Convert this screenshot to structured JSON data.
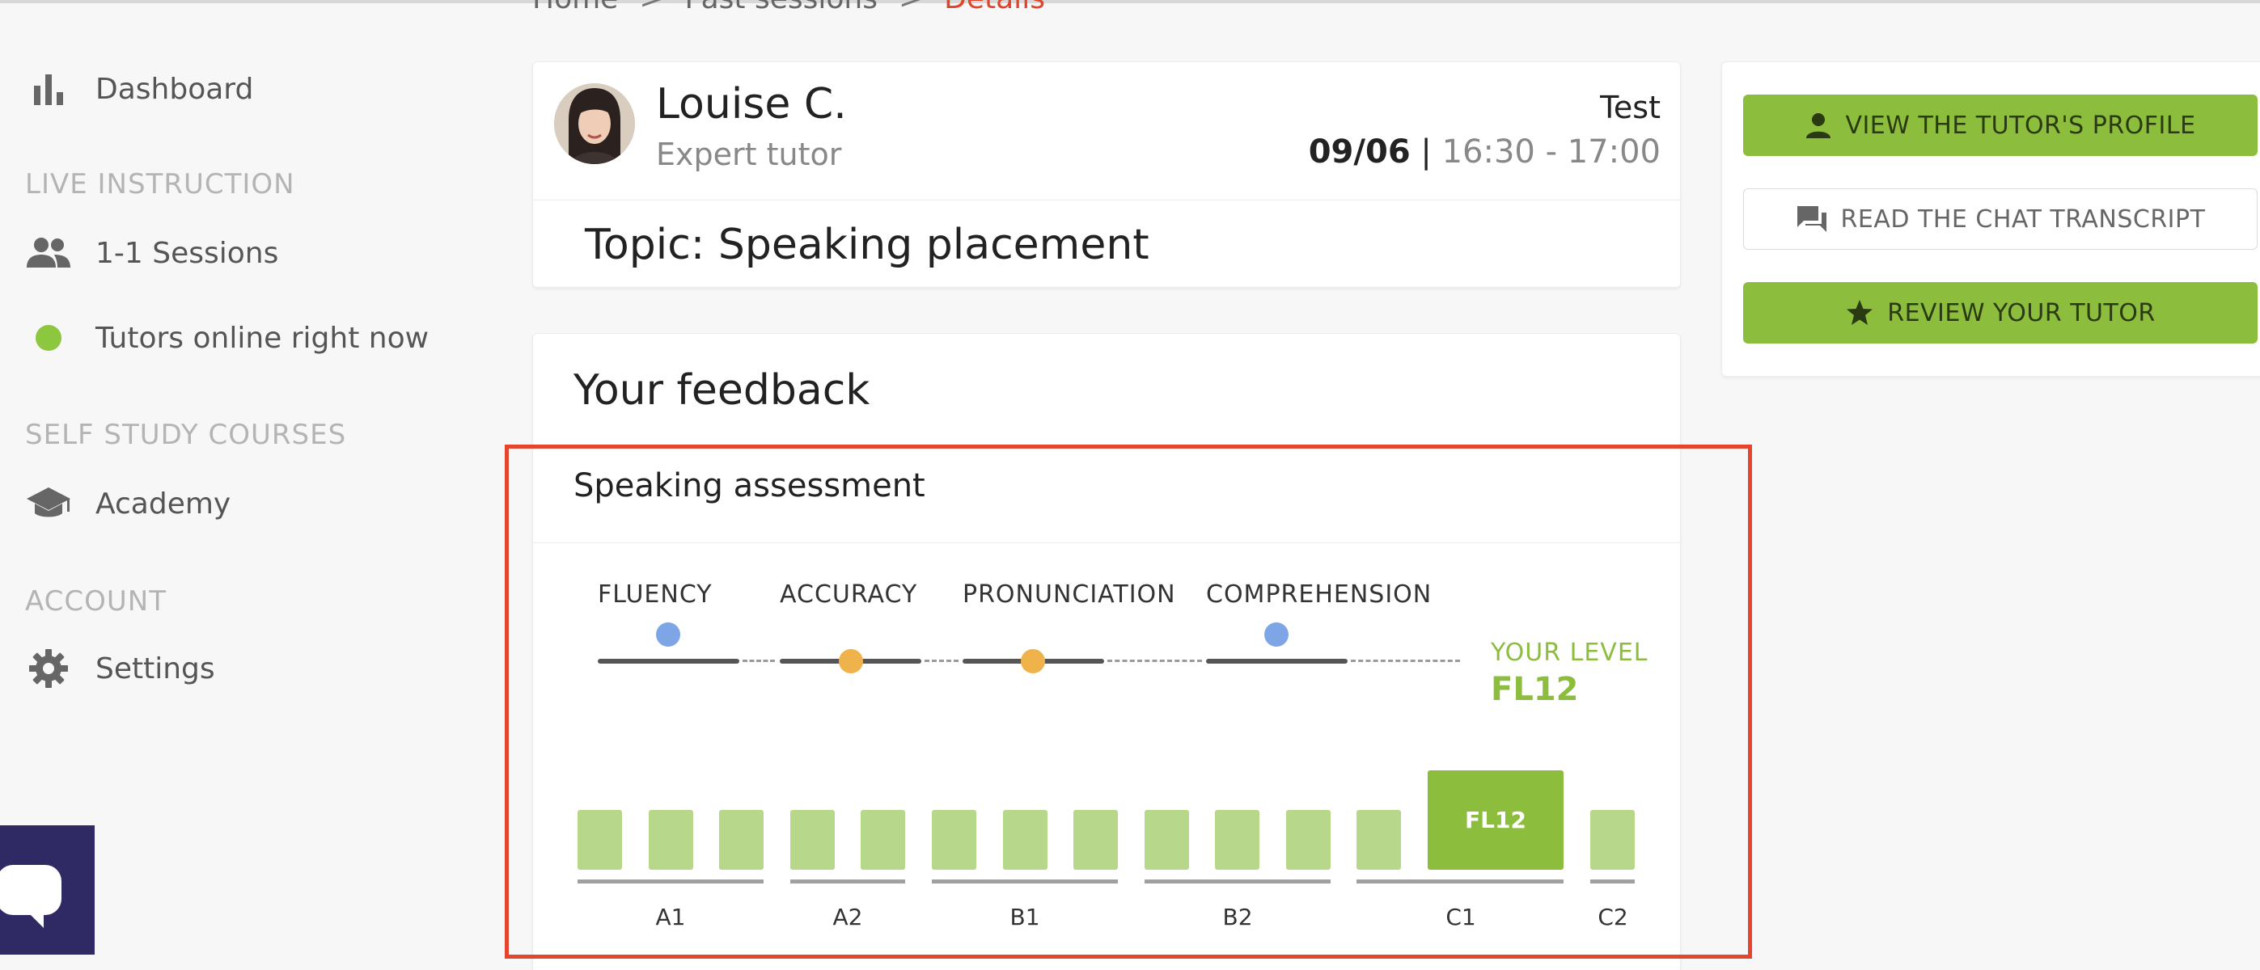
{
  "breadcrumb": {
    "home": "Home",
    "sep1": ">",
    "past": "Past sessions",
    "sep2": ">",
    "current": "Details"
  },
  "sidebar": {
    "dashboard": "Dashboard",
    "live_instruction": "LIVE INSTRUCTION",
    "sessions": "1-1 Sessions",
    "tutors_online": "Tutors online right now",
    "self_study": "SELF STUDY COURSES",
    "academy": "Academy",
    "account": "ACCOUNT",
    "settings": "Settings"
  },
  "tutor": {
    "name": "Louise C.",
    "role": "Expert tutor",
    "session_type": "Test",
    "date": "09/06",
    "separator": "|",
    "time": "16:30 - 17:00",
    "topic": "Topic: Speaking placement"
  },
  "actions": {
    "view_profile": "VIEW THE TUTOR'S PROFILE",
    "read_chat": "READ THE CHAT TRANSCRIPT",
    "review": "REVIEW YOUR TUTOR"
  },
  "feedback": {
    "title": "Your feedback",
    "assessment_title": "Speaking assessment",
    "skills": [
      {
        "label": "FLUENCY",
        "marker": "blue"
      },
      {
        "label": "ACCURACY",
        "marker": "orange"
      },
      {
        "label": "PRONUNCIATION",
        "marker": "orange"
      },
      {
        "label": "COMPREHENSION",
        "marker": "blue"
      }
    ],
    "your_level_label": "YOUR LEVEL",
    "your_level": "FL12",
    "levels": [
      "A1",
      "A2",
      "B1",
      "B2",
      "C1",
      "C2"
    ],
    "current_level_bar": "FL12"
  },
  "colors": {
    "accent_green": "#8dbd3d",
    "light_green": "#b7d78a",
    "highlight_red": "#e3452f",
    "breadcrumb_current": "#e0442a",
    "marker_blue": "#7ea6e6",
    "marker_orange": "#f0b24a",
    "online_green": "#8dc63f",
    "chat_widget": "#2f2a64"
  }
}
